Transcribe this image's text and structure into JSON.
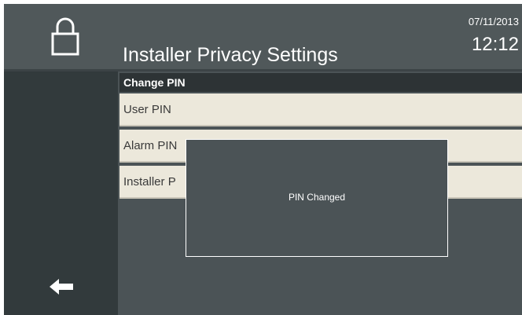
{
  "header": {
    "title": "Installer Privacy Settings",
    "date": "07/11/2013",
    "time": "12:12",
    "lock_icon": "padlock-icon"
  },
  "sidebar": {
    "back_icon": "left-arrow-icon"
  },
  "section": {
    "title": "Change PIN"
  },
  "rows": [
    {
      "label": "User PIN"
    },
    {
      "label": "Alarm PIN"
    },
    {
      "label": "Installer P"
    }
  ],
  "dialog": {
    "message": "PIN Changed"
  },
  "colors": {
    "header_bg": "#50585a",
    "sidebar_bg": "#323a3c",
    "row_bg": "#ece8db",
    "section_header_bg": "#2d3335"
  }
}
